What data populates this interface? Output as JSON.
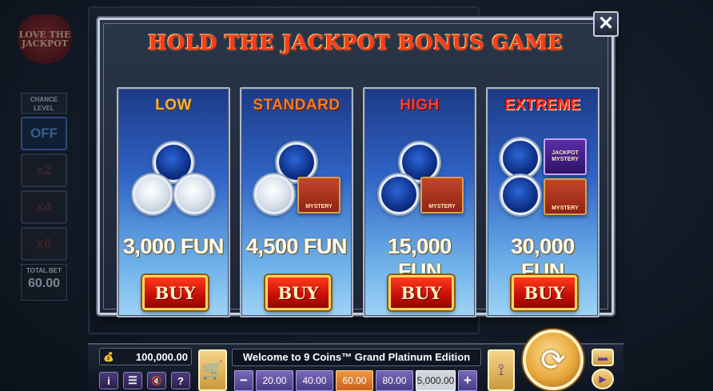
{
  "background": {
    "logo_text": "LOVE THE JACKPOT",
    "chance_level": {
      "title": "CHANCE LEVEL",
      "options": [
        "OFF",
        "x2",
        "x4",
        "x6"
      ],
      "selected": "OFF",
      "total_bet_label": "TOTAL BET",
      "total_bet_value": "60.00"
    }
  },
  "modal": {
    "title": "HOLD THE JACKPOT BONUS GAME",
    "close_symbol": "✕",
    "cards": [
      {
        "label": "LOW",
        "amount": "3,000 FUN",
        "buy_label": "BUY"
      },
      {
        "label": "STANDARD",
        "amount": "4,500 FUN",
        "buy_label": "BUY",
        "mystery_text": "MYSTERY"
      },
      {
        "label": "HIGH",
        "amount": "15,000 FUN",
        "buy_label": "BUY",
        "mystery_text": "MYSTERY"
      },
      {
        "label": "EXTREME",
        "amount": "30,000 FUN",
        "buy_label": "BUY",
        "mystery_text": "MYSTERY",
        "jackpot_mystery_text": "JACKPOT MYSTERY"
      }
    ]
  },
  "bottom_bar": {
    "balance": "100,000.00",
    "message": "Welcome to 9 Coins™ Grand Platinum Edition",
    "bet_options": [
      "20.00",
      "40.00",
      "60.00",
      "80.00",
      "5,000.00"
    ],
    "selected_bet": "60.00",
    "minus_symbol": "−",
    "plus_symbol": "+",
    "info_symbol": "i",
    "menu_symbol": "☰",
    "sound_symbol": "🔇",
    "help_symbol": "?",
    "icons": [
      "money-bag-icon",
      "info-icon",
      "menu-icon",
      "sound-off-icon",
      "help-icon",
      "cart-icon",
      "autoplay-icon",
      "spin-icon",
      "turbo-icon",
      "play-icon"
    ]
  }
}
